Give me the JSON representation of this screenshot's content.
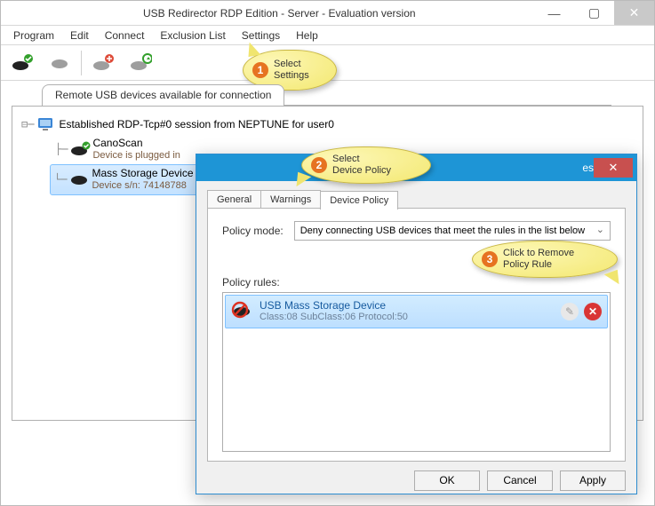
{
  "window": {
    "title": "USB Redirector RDP Edition - Server - Evaluation version"
  },
  "menubar": [
    "Program",
    "Edit",
    "Connect",
    "Exclusion List",
    "Settings",
    "Help"
  ],
  "main_tab": {
    "label": "Remote USB devices available for connection"
  },
  "tree": {
    "session": "Established RDP-Tcp#0 session from NEPTUNE for user0",
    "items": [
      {
        "name": "CanoScan",
        "sub": "Device is plugged in"
      },
      {
        "name": "Mass Storage Device",
        "sub": "Device s/n: 74148788"
      }
    ]
  },
  "dialog": {
    "title_hidden": "es",
    "tabs": [
      "General",
      "Warnings",
      "Device Policy"
    ],
    "active_tab": 2,
    "policy_mode_label": "Policy mode:",
    "policy_mode_value": "Deny connecting USB devices that meet the rules in the list below",
    "rules_label": "Policy rules:",
    "rules": [
      {
        "name": "USB Mass Storage Device",
        "sub": "Class:08  SubClass:06  Protocol:50"
      }
    ],
    "buttons": {
      "ok": "OK",
      "cancel": "Cancel",
      "apply": "Apply"
    }
  },
  "callouts": {
    "c1": {
      "num": "1",
      "text": "Select\nSettings"
    },
    "c2": {
      "num": "2",
      "text": "Select\nDevice Policy"
    },
    "c3": {
      "num": "3",
      "text": "Click to Remove\nPolicy Rule"
    }
  }
}
